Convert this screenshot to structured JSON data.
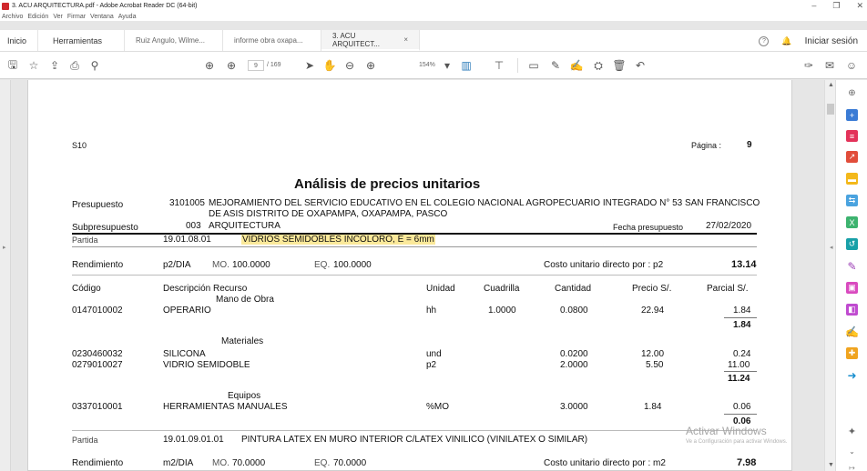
{
  "window": {
    "title": "3. ACU ARQUITECTURA.pdf - Adobe Acrobat Reader DC (64-bit)",
    "controls": [
      "–",
      "❐",
      "✕"
    ]
  },
  "menu": [
    "Archivo",
    "Edición",
    "Ver",
    "Firmar",
    "Ventana",
    "Ayuda"
  ],
  "tabs": {
    "home": "Inicio",
    "tools": "Herramientas",
    "docs": [
      "Ruiz Angulo, Wilme...",
      "informe obra oxapa...",
      "3. ACU ARQUITECT..."
    ],
    "close": "×",
    "help": "?",
    "bell": "🔔",
    "signin": "Iniciar sesión"
  },
  "toolbar": {
    "page_current": "9",
    "page_total": "/ 169",
    "zoom": "154%"
  },
  "page": {
    "s10": "S10",
    "pagina_label": "Página :",
    "pagina_num": "9",
    "title": "Análisis de precios unitarios",
    "presupuesto_label": "Presupuesto",
    "presupuesto_code": "3101005",
    "presupuesto_desc1": "MEJORAMIENTO DEL SERVICIO EDUCATIVO EN EL COLEGIO NACIONAL AGROPECUARIO INTEGRADO N° 53 SAN FRANCISCO",
    "presupuesto_desc2": "DE ASIS DISTRITO DE OXAPAMPA, OXAPAMPA, PASCO",
    "subpresupuesto_label": "Subpresupuesto",
    "subpresupuesto_code": "003",
    "subpresupuesto_name": "ARQUITECTURA",
    "fecha_label": "Fecha presupuesto",
    "fecha_value": "27/02/2020",
    "partida1": {
      "label": "Partida",
      "code": "19.01.08.01",
      "desc": "VIDRIOS SEMIDOBLES INCOLORO, E = 6mm",
      "rend_label": "Rendimiento",
      "rend_unit": "p2/DIA",
      "mo": "MO.",
      "mo_val": "100.0000",
      "eq": "EQ.",
      "eq_val": "100.0000",
      "costo_label": "Costo unitario directo por : p2",
      "costo_val": "13.14"
    },
    "headers": {
      "codigo": "Código",
      "descripcion": "Descripción Recurso",
      "unidad": "Unidad",
      "cuadrilla": "Cuadrilla",
      "cantidad": "Cantidad",
      "precio": "Precio S/.",
      "parcial": "Parcial S/."
    },
    "groups": {
      "mano": "Mano de Obra",
      "materiales": "Materiales",
      "equipos": "Equipos"
    },
    "rows": [
      {
        "code": "0147010002",
        "desc": "OPERARIO",
        "unit": "hh",
        "cuad": "1.0000",
        "cant": "0.0800",
        "price": "22.94",
        "parcial": "1.84"
      },
      {
        "code": "0230460032",
        "desc": "SILICONA",
        "unit": "und",
        "cuad": "",
        "cant": "0.0200",
        "price": "12.00",
        "parcial": "0.24"
      },
      {
        "code": "0279010027",
        "desc": "VIDRIO SEMIDOBLE",
        "unit": "p2",
        "cuad": "",
        "cant": "2.0000",
        "price": "5.50",
        "parcial": "11.00"
      },
      {
        "code": "0337010001",
        "desc": "HERRAMIENTAS MANUALES",
        "unit": "%MO",
        "cuad": "",
        "cant": "3.0000",
        "price": "1.84",
        "parcial": "0.06"
      }
    ],
    "subtotals": {
      "mano": "1.84",
      "materiales": "11.24",
      "equipos": "0.06"
    },
    "partida2": {
      "label": "Partida",
      "code": "19.01.09.01.01",
      "desc": "PINTURA LATEX EN MURO INTERIOR C/LATEX VINILICO (VINILATEX O SIMILAR)",
      "rend_label": "Rendimiento",
      "rend_unit": "m2/DIA",
      "mo": "MO.",
      "mo_val": "70.0000",
      "eq": "EQ.",
      "eq_val": "70.0000",
      "costo_label": "Costo unitario directo por : m2",
      "costo_val": "7.98"
    }
  },
  "watermark": {
    "line1": "Activar Windows",
    "line2": "Ve a Configuración para activar Windows."
  },
  "colors": {
    "highlight": "#fbe99a",
    "acrobat_red": "#d0282d"
  }
}
